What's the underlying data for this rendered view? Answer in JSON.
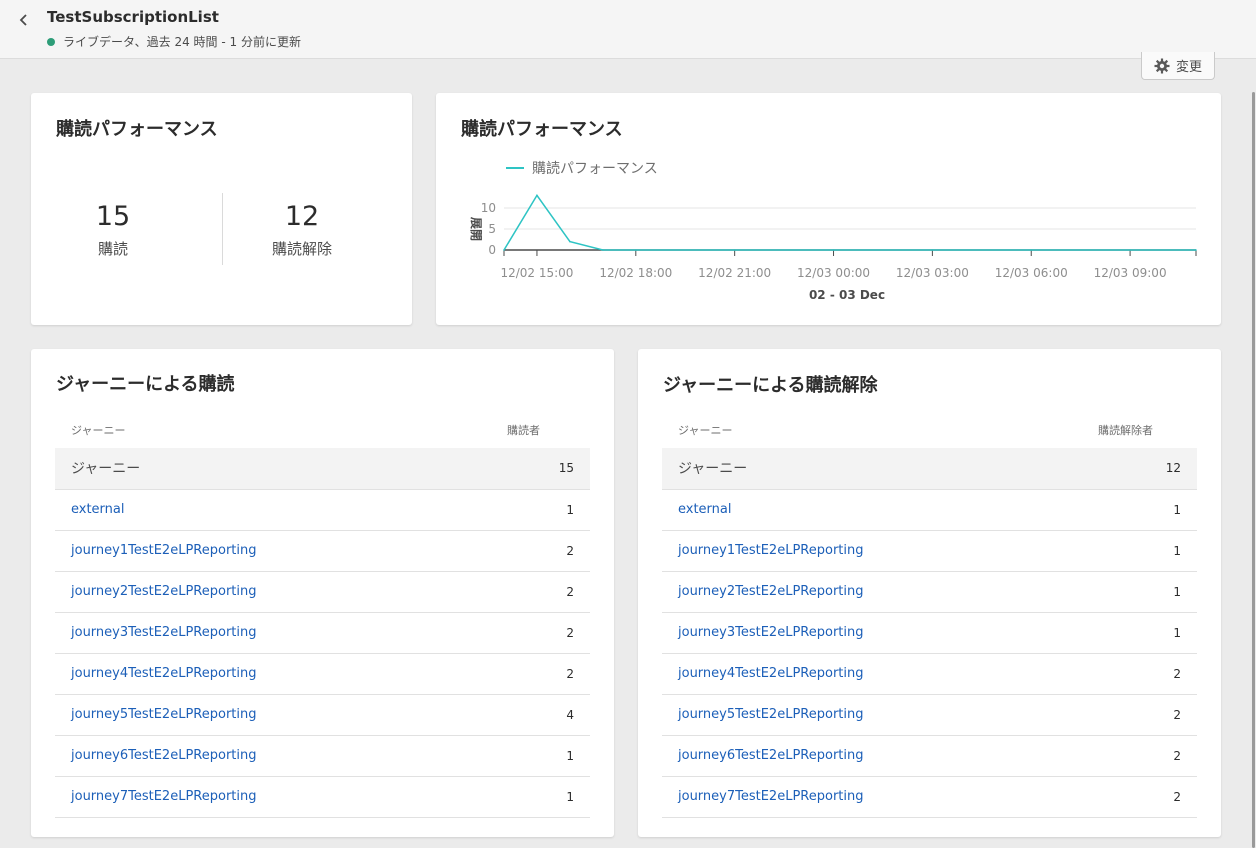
{
  "header": {
    "title": "TestSubscriptionList",
    "status": "ライブデータ、過去 24 時間 - 1 分前に更新",
    "status_color": "#2d9d78"
  },
  "toolbar": {
    "change_label": "変更",
    "change_icon": "gear-icon"
  },
  "kpi_card": {
    "title": "購読パフォーマンス",
    "subscriptions": {
      "value": "15",
      "label": "購読"
    },
    "unsubscriptions": {
      "value": "12",
      "label": "購読解除"
    }
  },
  "chart_card": {
    "title": "購読パフォーマンス",
    "chart_data": {
      "type": "line",
      "legend": "購読パフォーマンス",
      "series_color": "#2ec4c4",
      "ylabel": "展開",
      "xlabel": "02 - 03 Dec",
      "yticks": [
        "10",
        "5",
        "0"
      ],
      "ylim": [
        0,
        10
      ],
      "xticks": [
        "12/02 15:00",
        "12/02 18:00",
        "12/02 21:00",
        "12/03 00:00",
        "12/03 03:00",
        "12/03 06:00",
        "12/03 09:00"
      ],
      "x": [
        "12/02 14:00",
        "12/02 15:00",
        "12/02 16:00",
        "12/02 17:00",
        "12/02 18:00",
        "12/02 21:00",
        "12/03 00:00",
        "12/03 03:00",
        "12/03 06:00",
        "12/03 09:00",
        "12/03 11:00"
      ],
      "values": [
        0,
        13,
        2,
        0,
        0,
        0,
        0,
        0,
        0,
        0,
        0
      ]
    }
  },
  "subs_table": {
    "title": "ジャーニーによる購読",
    "col_journey": "ジャーニー",
    "col_count": "購読者",
    "total_label": "ジャーニー",
    "total_value": "15",
    "rows": [
      {
        "name": "external",
        "value": "1"
      },
      {
        "name": "journey1TestE2eLPReporting",
        "value": "2"
      },
      {
        "name": "journey2TestE2eLPReporting",
        "value": "2"
      },
      {
        "name": "journey3TestE2eLPReporting",
        "value": "2"
      },
      {
        "name": "journey4TestE2eLPReporting",
        "value": "2"
      },
      {
        "name": "journey5TestE2eLPReporting",
        "value": "4"
      },
      {
        "name": "journey6TestE2eLPReporting",
        "value": "1"
      },
      {
        "name": "journey7TestE2eLPReporting",
        "value": "1"
      }
    ]
  },
  "unsubs_table": {
    "title": "ジャーニーによる購読解除",
    "col_journey": "ジャーニー",
    "col_count": "購読解除者",
    "total_label": "ジャーニー",
    "total_value": "12",
    "rows": [
      {
        "name": "external",
        "value": "1"
      },
      {
        "name": "journey1TestE2eLPReporting",
        "value": "1"
      },
      {
        "name": "journey2TestE2eLPReporting",
        "value": "1"
      },
      {
        "name": "journey3TestE2eLPReporting",
        "value": "1"
      },
      {
        "name": "journey4TestE2eLPReporting",
        "value": "2"
      },
      {
        "name": "journey5TestE2eLPReporting",
        "value": "2"
      },
      {
        "name": "journey6TestE2eLPReporting",
        "value": "2"
      },
      {
        "name": "journey7TestE2eLPReporting",
        "value": "2"
      }
    ]
  }
}
